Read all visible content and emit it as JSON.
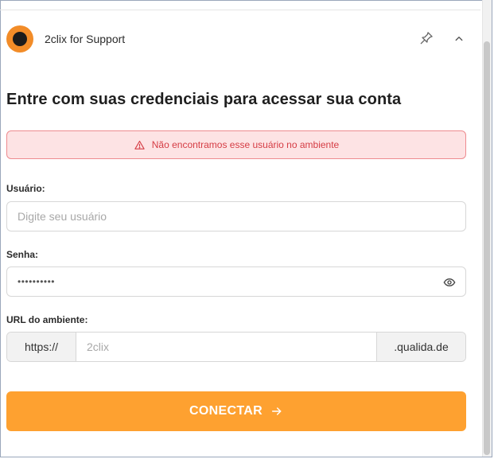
{
  "header": {
    "app_title": "2clix for Support",
    "logo_icon": "circle-logo-icon",
    "pin_icon": "pin-icon",
    "collapse_icon": "chevron-up-icon"
  },
  "main": {
    "heading": "Entre com suas credenciais para acessar sua conta",
    "alert": {
      "icon": "warning-triangle-icon",
      "message": "Não encontramos esse usuário no ambiente"
    },
    "username": {
      "label": "Usuário:",
      "placeholder": "Digite seu usuário",
      "value": ""
    },
    "password": {
      "label": "Senha:",
      "value_masked": "••••••••••",
      "toggle_icon": "eye-icon"
    },
    "environment_url": {
      "label": "URL do ambiente:",
      "prefix": "https://",
      "placeholder": "2clix",
      "suffix": ".qualida.de"
    },
    "connect_button": {
      "label": "CONECTAR",
      "icon": "arrow-right-icon"
    }
  },
  "colors": {
    "accent": "#fea130",
    "logo": "#f28c28",
    "alert_background": "#fde3e4",
    "alert_border": "#ee8b8f",
    "alert_text": "#d53c44"
  }
}
